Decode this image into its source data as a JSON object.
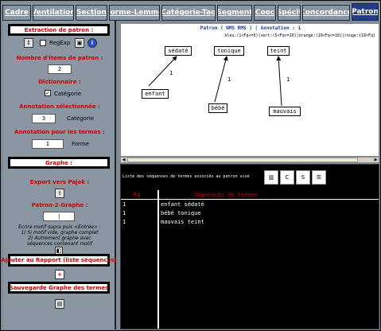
{
  "tabs": [
    {
      "label": "Cadre",
      "active": false
    },
    {
      "label": "Ventilation",
      "active": false
    },
    {
      "label": "Section",
      "active": false
    },
    {
      "label": "Forme-Lemme",
      "active": false
    },
    {
      "label": "Catégorie-Tag",
      "active": false
    },
    {
      "label": "Segment",
      "active": false
    },
    {
      "label": "Cooc",
      "active": false
    },
    {
      "label": "Spécif",
      "active": false
    },
    {
      "label": "Concordance",
      "active": false
    },
    {
      "label": "Patron",
      "active": true
    }
  ],
  "sidebar": {
    "extraction_title": "Extraction de patron :",
    "regexp_label": "RegExp",
    "nb_items_label": "Nombre d'items de patron :",
    "nb_items_value": "2",
    "dictionnaire_label": "Dictionnaire :",
    "categorie_label": "Catégorie",
    "categorie_checked": "✓",
    "annotation_sel_label": "Annotation sélectionnée :",
    "annotation_value": "3",
    "annotation_unit": "Categorie",
    "annotation_termes_label": "Annotation pour les termes :",
    "annotation_termes_value": "1",
    "annotation_termes_unit": "Forme",
    "graphe_title": "Graphe :",
    "export_label": "Export vers Pajek :",
    "patron_graphe_label": "Patron-2-Graphe :",
    "note_line1": "Ecrire motif supra puis <Entrée> :",
    "note_line2": "1) Si motif vide, graphe complet",
    "note_line3": "2) Autrement graphe avec",
    "note_line4": "séquences contenant motif",
    "ajouter_title": "Ajouter au Rapport (liste séquences)",
    "sauvegarde_title": "Sauvegarde Graphe des termes"
  },
  "graph": {
    "title": "Patron ( NMS RMS ) | Annotation : 1",
    "legend": "bleu:(1<Fq<=5)|vert:(5<Fq<=10)|orange:(10<Fq<=18)|rouge:(18<Fq)",
    "nodes": {
      "sedate": "sédaté",
      "tonique": "tonique",
      "teint": "teint",
      "enfant": "enfant",
      "bebe": "bébé",
      "mauvais": "mauvais"
    },
    "edge_labels": {
      "e1": "1",
      "e2": "1",
      "e3": "1"
    }
  },
  "bottom": {
    "caption": "Liste des séquences de termes associés au patron visé",
    "col_fq": "Fq",
    "col_seq": "Séquences de termes",
    "rows": [
      {
        "fq": "1",
        "seq": "enfant sédaté"
      },
      {
        "fq": "1",
        "seq": "bébé tonique"
      },
      {
        "fq": "1",
        "seq": "mauvais teint"
      }
    ]
  }
}
